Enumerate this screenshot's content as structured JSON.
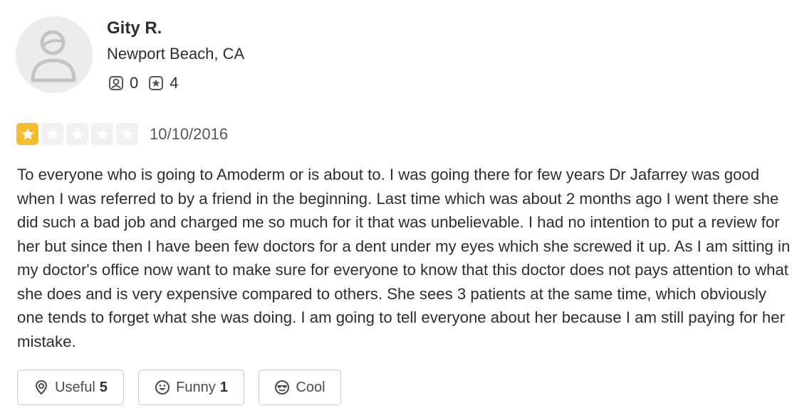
{
  "user": {
    "name": "Gity R.",
    "location": "Newport Beach, CA",
    "friends_count": "0",
    "reviews_count": "4"
  },
  "review": {
    "rating": 1,
    "rating_max": 5,
    "date": "10/10/2016",
    "text": "To everyone who is going to Amoderm or is about to. I was going there for few years Dr Jafarrey was good when I was referred to by a friend in the beginning. Last time which was about 2 months ago I went there she did such a bad job and charged me so much for it that was unbelievable. I had no intention to put a review for her but since then I have been few doctors for a dent under my eyes which she screwed it up. As I am sitting in my doctor's office now want to make sure for everyone to know that this doctor does not pays attention to what she does and is very expensive compared to others. She sees 3 patients at the same time, which obviously one tends to forget what she was doing. I am going to tell everyone about her because I am still paying for her mistake."
  },
  "actions": {
    "useful_label": "Useful",
    "useful_count": "5",
    "funny_label": "Funny",
    "funny_count": "1",
    "cool_label": "Cool"
  },
  "icons": {
    "avatar": "default-user-avatar-icon",
    "friends": "friends-icon",
    "reviews": "review-star-icon",
    "useful": "lightbulb-location-icon",
    "funny": "smiley-face-icon",
    "cool": "sunglasses-face-icon"
  },
  "colors": {
    "star_filled": "#f5be2e",
    "star_empty": "#f1f1f1",
    "text": "#2d2e2f",
    "muted": "#565758",
    "border": "#c8c9ca"
  }
}
